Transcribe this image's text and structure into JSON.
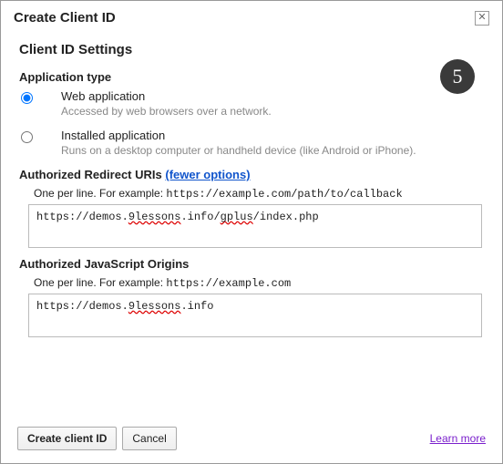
{
  "dialog_title": "Create Client ID",
  "settings_title": "Client ID Settings",
  "step_number": "5",
  "app_type": {
    "heading": "Application type",
    "options": [
      {
        "label": "Web application",
        "desc": "Accessed by web browsers over a network."
      },
      {
        "label": "Installed application",
        "desc": "Runs on a desktop computer or handheld device (like Android or iPhone)."
      }
    ]
  },
  "redirect": {
    "heading": "Authorized Redirect URIs ",
    "toggle": "(fewer options)",
    "hint_prefix": "One per line. For example: ",
    "hint_example": "https://example.com/path/to/callback",
    "value_parts": {
      "a": "https://demos.",
      "b": "9lessons",
      "c": ".info/",
      "d": "gplus",
      "e": "/index.php"
    }
  },
  "js_origins": {
    "heading": "Authorized JavaScript Origins",
    "hint_prefix": "One per line. For example: ",
    "hint_example": "https://example.com",
    "value_parts": {
      "a": "https://demos.",
      "b": "9lessons",
      "c": ".info"
    }
  },
  "footer": {
    "create": "Create client ID",
    "cancel": "Cancel",
    "learn_more": "Learn more"
  }
}
